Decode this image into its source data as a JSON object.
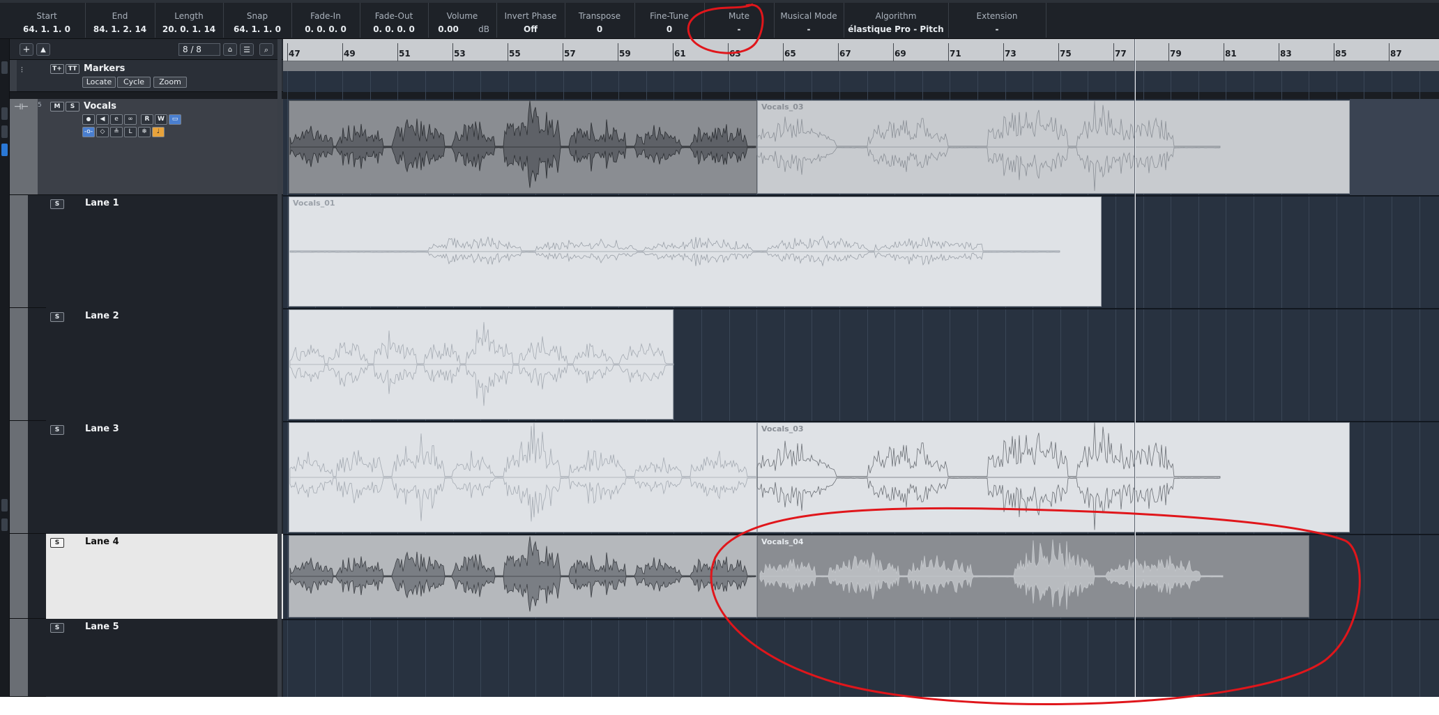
{
  "infoline": {
    "fields": [
      {
        "label": "Start",
        "value": "64. 1. 1.   0"
      },
      {
        "label": "End",
        "value": "84. 1. 2. 14"
      },
      {
        "label": "Length",
        "value": "20. 0. 1. 14"
      },
      {
        "label": "Snap",
        "value": "64. 1. 1.   0"
      },
      {
        "label": "Fade-In",
        "value": "0. 0. 0.   0"
      },
      {
        "label": "Fade-Out",
        "value": "0. 0. 0.   0"
      },
      {
        "label": "Volume",
        "value": "0.00",
        "unit": "dB"
      },
      {
        "label": "Invert Phase",
        "value": "Off"
      },
      {
        "label": "Transpose",
        "value": "0"
      },
      {
        "label": "Fine-Tune",
        "value": "0"
      },
      {
        "label": "Mute",
        "value": "-"
      },
      {
        "label": "Musical Mode",
        "value": "-"
      },
      {
        "label": "Algorithm",
        "value": "élastique Pro - Pitch"
      },
      {
        "label": "Extension",
        "value": "-"
      }
    ]
  },
  "toolbar": {
    "page_counter": "8 / 8"
  },
  "tracks": {
    "markers": {
      "name": "Markers",
      "buttons": [
        "Locate",
        "Cycle",
        "Zoom"
      ]
    },
    "vocals": {
      "name": "Vocals",
      "number": "5",
      "mute": "M",
      "solo": "S",
      "read": "R",
      "write": "W"
    },
    "lanes": [
      {
        "name": "Lane 1",
        "solo": "S"
      },
      {
        "name": "Lane 2",
        "solo": "S"
      },
      {
        "name": "Lane 3",
        "solo": "S"
      },
      {
        "name": "Lane 4",
        "solo": "S"
      },
      {
        "name": "Lane 5",
        "solo": "S"
      }
    ]
  },
  "ruler": {
    "bars": [
      "47",
      "49",
      "51",
      "53",
      "55",
      "57",
      "59",
      "61",
      "63",
      "65",
      "67",
      "69",
      "71",
      "73",
      "75",
      "77",
      "79",
      "81",
      "83",
      "85",
      "87"
    ]
  },
  "events": {
    "vocals_comp": "Vocals_03",
    "lane1": "Vocals_01",
    "lane3": "Vocals_03",
    "lane4": "Vocals_04"
  },
  "colors": {
    "annotation": "#e0161b",
    "selected_lane": "#e8e8e8",
    "event_light": "#dfe2e6",
    "event_dark": "#8a8d92"
  }
}
